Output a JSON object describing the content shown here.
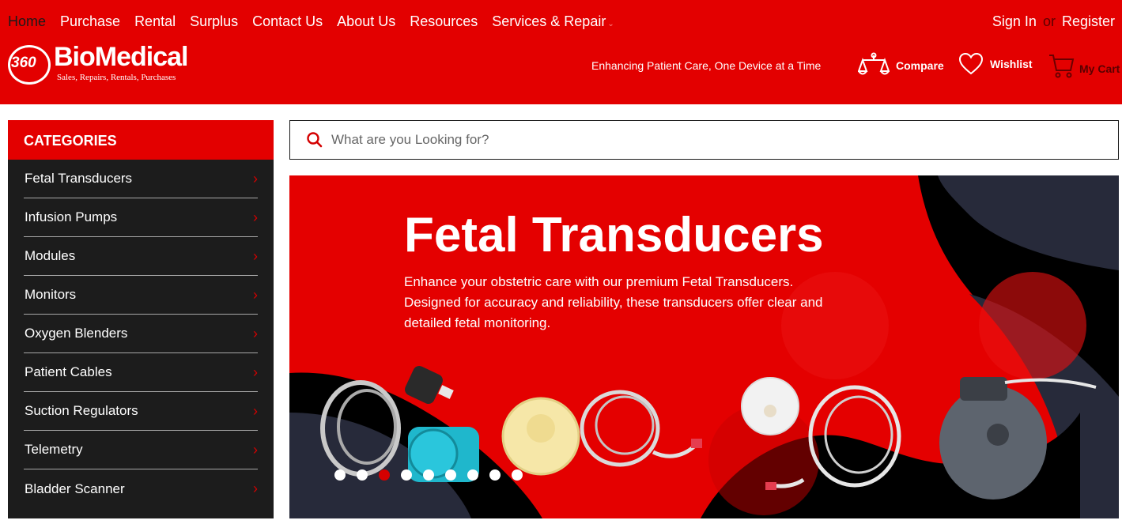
{
  "nav": {
    "items": [
      {
        "label": "Home",
        "active": true
      },
      {
        "label": "Purchase"
      },
      {
        "label": "Rental"
      },
      {
        "label": "Surplus"
      },
      {
        "label": "Contact Us"
      },
      {
        "label": "About Us"
      },
      {
        "label": "Resources"
      },
      {
        "label": "Services & Repair",
        "has_dropdown": true
      }
    ],
    "dropdown_icon": "chevron-down-icon"
  },
  "auth": {
    "sign_in": "Sign In",
    "or": "or",
    "register": "Register"
  },
  "logo": {
    "number": "360",
    "name": "BioMedical",
    "tagline": "Sales, Repairs, Rentals, Purchases"
  },
  "header": {
    "tagline": "Enhancing Patient Care, One Device at a Time",
    "compare": "Compare",
    "wishlist": "Wishlist",
    "cart": "My Cart"
  },
  "sidebar": {
    "title": "CATEGORIES",
    "items": [
      {
        "label": "Fetal Transducers"
      },
      {
        "label": "Infusion Pumps"
      },
      {
        "label": "Modules"
      },
      {
        "label": "Monitors"
      },
      {
        "label": "Oxygen Blenders"
      },
      {
        "label": "Patient Cables"
      },
      {
        "label": "Suction Regulators"
      },
      {
        "label": "Telemetry"
      },
      {
        "label": "Bladder Scanner"
      }
    ]
  },
  "search": {
    "placeholder": "What are you Looking for?",
    "value": ""
  },
  "banner": {
    "title": "Fetal Transducers",
    "text": "Enhance your obstetric care with our premium Fetal Transducers. Designed for accuracy and reliability, these transducers offer clear and detailed fetal monitoring.",
    "slides_total": 9,
    "active_slide": 3
  },
  "colors": {
    "brand_red": "#e30000",
    "sidebar_bg": "#1c1c1c",
    "accent_dark_red": "#d40000"
  }
}
